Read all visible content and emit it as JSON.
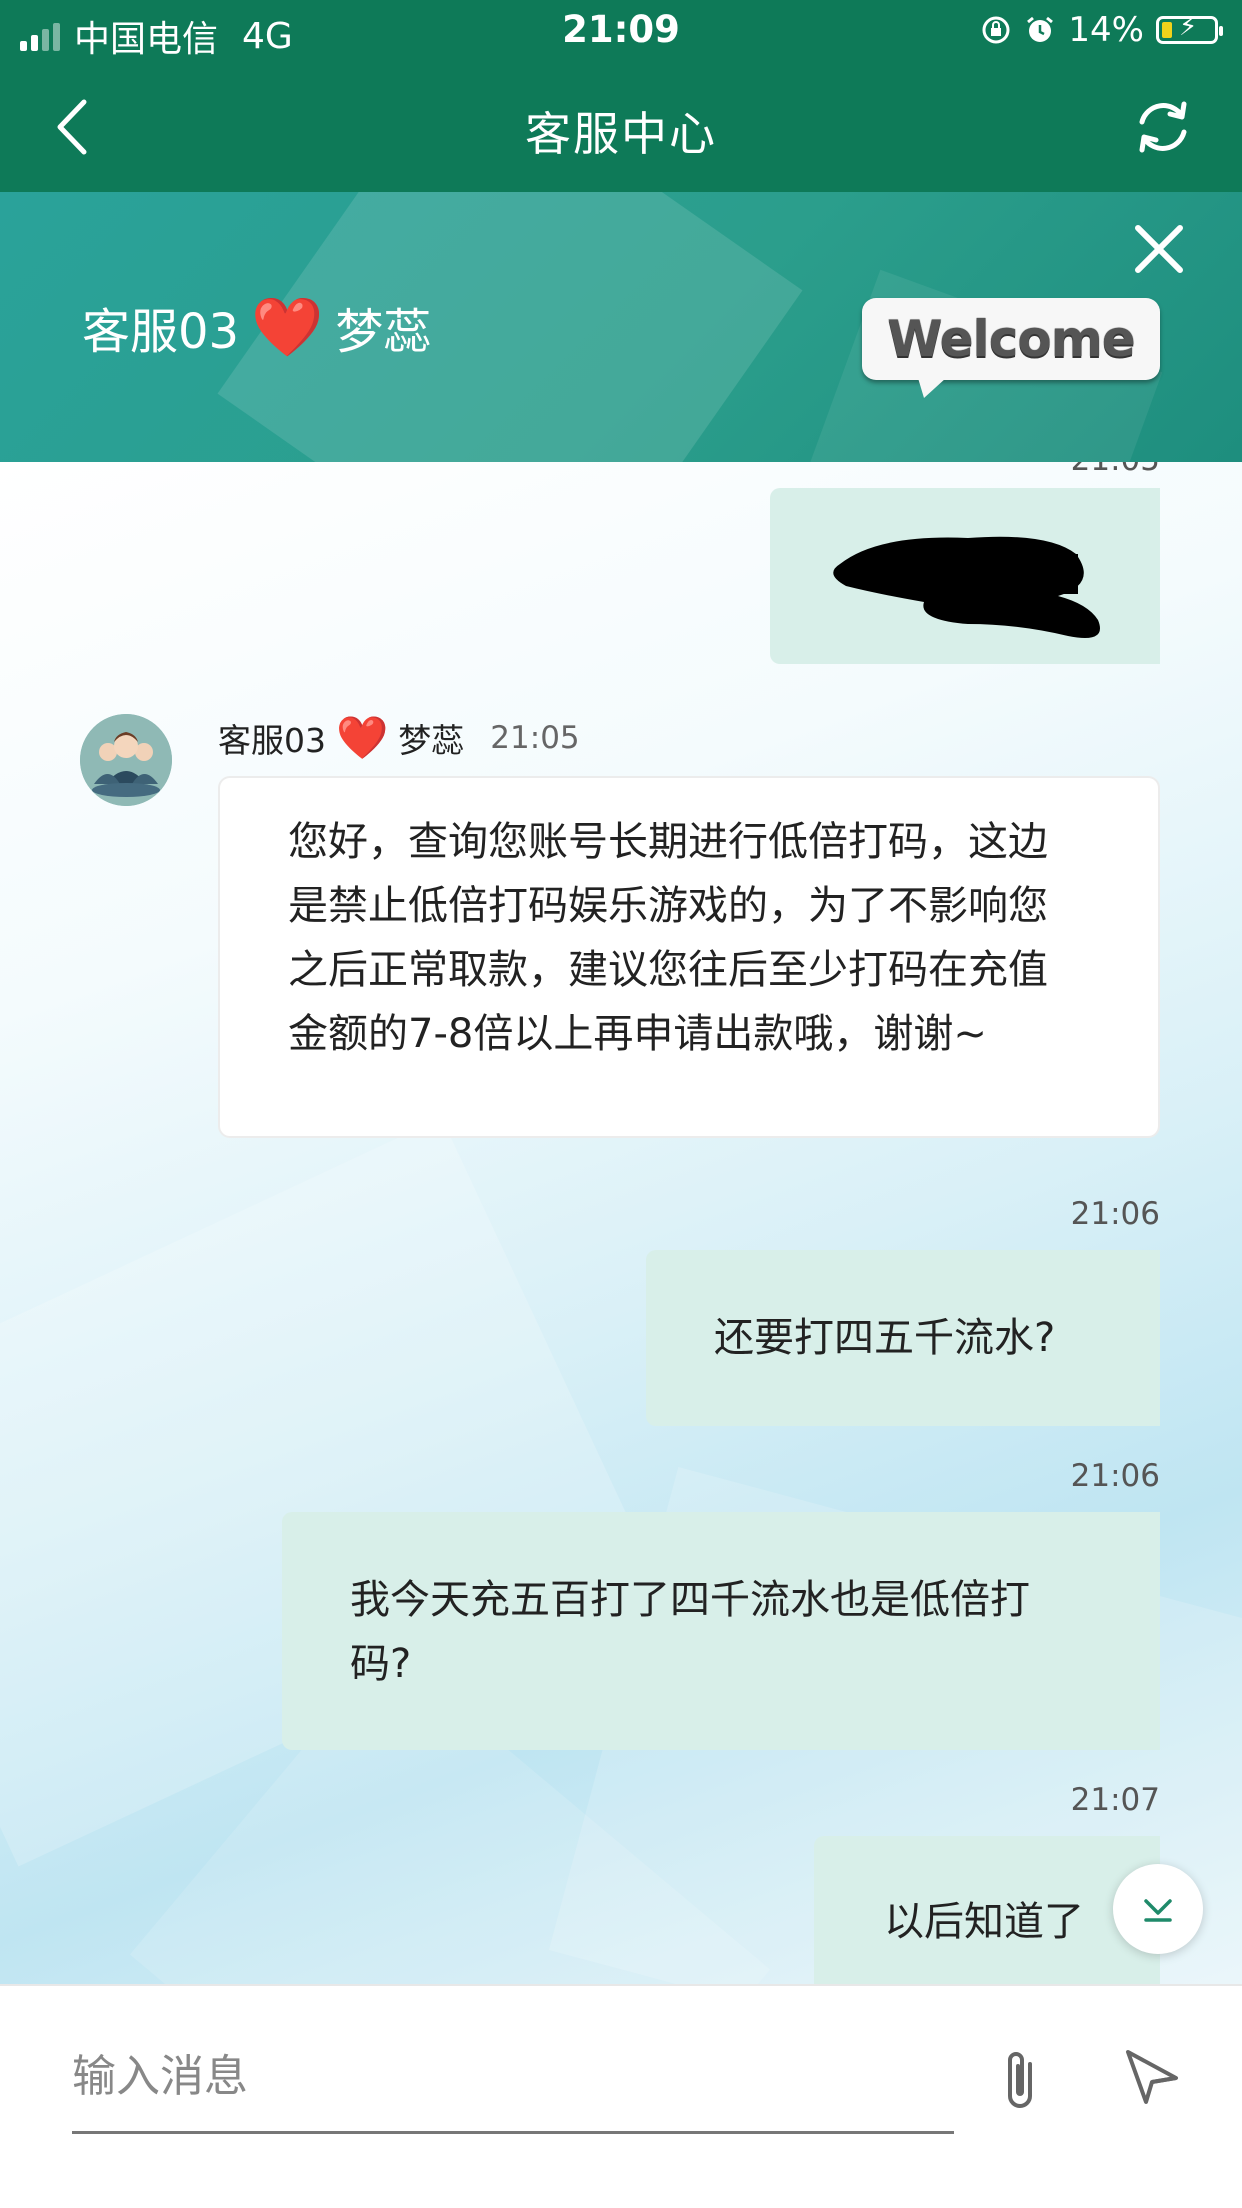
{
  "status_bar": {
    "carrier": "中国电信",
    "network": "4G",
    "time": "21:09",
    "battery": "14%",
    "icons": [
      "signal-icon",
      "orientation-lock-icon",
      "alarm-icon",
      "battery-charging-icon"
    ]
  },
  "nav": {
    "title": "客服中心",
    "back_icon": "chevron-left-icon",
    "refresh_icon": "refresh-icon"
  },
  "banner": {
    "agent_prefix": "客服03",
    "agent_suffix": "梦蕊",
    "heart": "❤️",
    "welcome_text": "Welcome",
    "close_icon": "close-icon"
  },
  "chat": {
    "partial_time": "21:05",
    "messages": [
      {
        "sender_prefix": "客服03",
        "sender_suffix": "梦蕊",
        "time": "21:05",
        "lines": [
          "您好，查询您账号长期进行低倍打码，这边",
          "是禁止低倍打码娱乐游戏的，为了不影响您",
          "之后正常取款，建议您往后至少打码在充值",
          "金额的7-8倍以上再申请出款哦，谢谢~"
        ]
      },
      {
        "time": "21:06",
        "text": "还要打四五千流水?"
      },
      {
        "time": "21:06",
        "lines": [
          "我今天充五百打了四千流水也是低倍打",
          "码?"
        ]
      },
      {
        "time": "21:07",
        "text": "以后知道了"
      }
    ]
  },
  "input_bar": {
    "placeholder": "输入消息",
    "attach_icon": "paperclip-icon",
    "send_icon": "send-icon"
  },
  "colors": {
    "header_green": "#0e7a58",
    "banner_teal": "#2aa29a",
    "outgoing_bubble": "#d8efe9",
    "heart_red": "#e2262b"
  }
}
